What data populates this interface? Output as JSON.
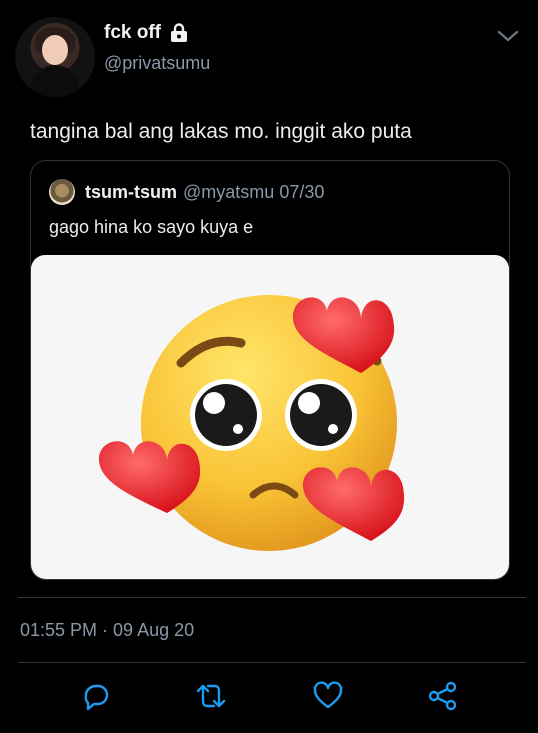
{
  "tweet": {
    "display_name": "fck off",
    "handle": "@privatsumu",
    "text": "tangina bal ang lakas mo. inggit ako puta",
    "timestamp": "01:55 PM · 09 Aug 20",
    "icons": {
      "lock": "lock-icon",
      "menu": "chevron-down-icon",
      "reply": "reply-icon",
      "retweet": "retweet-icon",
      "like": "heart-icon",
      "share": "share-icon"
    }
  },
  "quoted": {
    "display_name": "tsum-tsum",
    "handle": "@myatsmu",
    "date": "07/30",
    "text": "gago hina ko sayo kuya e",
    "media": "pleading-face-emoji-with-hearts"
  },
  "colors": {
    "background": "#000000",
    "muted": "#8b98a5",
    "border": "#2f3336"
  }
}
